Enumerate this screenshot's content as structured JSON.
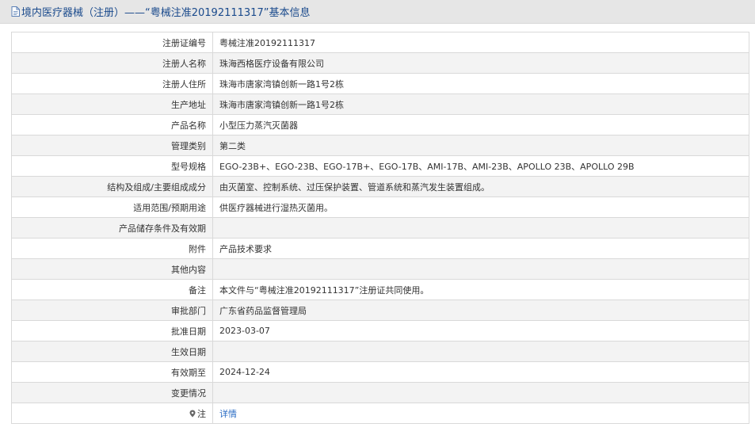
{
  "header": {
    "icon": "document-icon",
    "title": "境内医疗器械（注册）——“粤械注准20192111317”基本信息"
  },
  "rows": [
    {
      "label": "注册证编号",
      "value": "粤械注准20192111317"
    },
    {
      "label": "注册人名称",
      "value": "珠海西格医疗设备有限公司"
    },
    {
      "label": "注册人住所",
      "value": "珠海市唐家湾镇创新一路1号2栋"
    },
    {
      "label": "生产地址",
      "value": "珠海市唐家湾镇创新一路1号2栋"
    },
    {
      "label": "产品名称",
      "value": "小型压力蒸汽灭菌器"
    },
    {
      "label": "管理类别",
      "value": "第二类"
    },
    {
      "label": "型号规格",
      "value": "EGO-23B+、EGO-23B、EGO-17B+、EGO-17B、AMI-17B、AMI-23B、APOLLO 23B、APOLLO 29B"
    },
    {
      "label": "结构及组成/主要组成成分",
      "value": "由灭菌室、控制系统、过压保护装置、管道系统和蒸汽发生装置组成。"
    },
    {
      "label": "适用范围/预期用途",
      "value": "供医疗器械进行湿热灭菌用。"
    },
    {
      "label": "产品储存条件及有效期",
      "value": ""
    },
    {
      "label": "附件",
      "value": "产品技术要求"
    },
    {
      "label": "其他内容",
      "value": ""
    },
    {
      "label": "备注",
      "value": "本文件与“粤械注准20192111317”注册证共同使用。"
    },
    {
      "label": "审批部门",
      "value": "广东省药品监督管理局"
    },
    {
      "label": "批准日期",
      "value": "2023-03-07"
    },
    {
      "label": "生效日期",
      "value": ""
    },
    {
      "label": "有效期至",
      "value": "2024-12-24"
    },
    {
      "label": "变更情况",
      "value": ""
    }
  ],
  "note_row": {
    "icon": "pin-icon",
    "label": "注",
    "link_text": "详情"
  },
  "colors": {
    "header_bg": "#e6e6e6",
    "title_text": "#1a4a8c",
    "link": "#2a6cc4",
    "border": "#d9d9d9",
    "row_alt": "#f3f3f3"
  }
}
